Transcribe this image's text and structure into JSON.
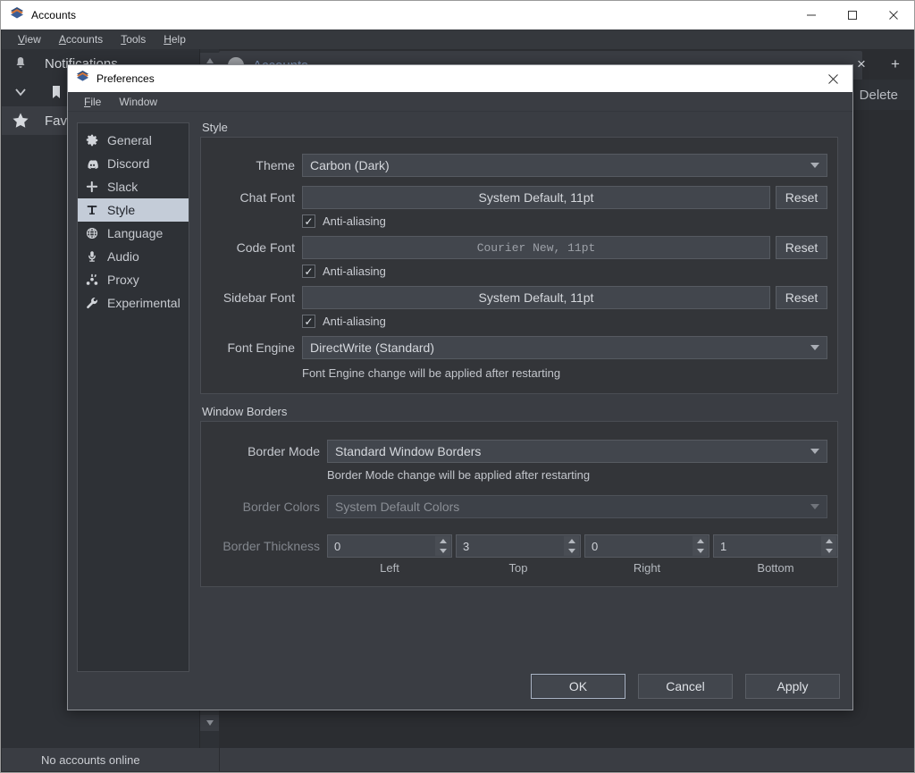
{
  "app": {
    "title": "Accounts",
    "title_icon": "app-logo-icon",
    "window_controls": [
      {
        "name": "minimize-button",
        "glyph": "minimize-icon"
      },
      {
        "name": "maximize-button",
        "glyph": "maximize-icon"
      },
      {
        "name": "close-button",
        "glyph": "close-icon"
      }
    ],
    "menus": [
      {
        "label": "View",
        "accel": "V"
      },
      {
        "label": "Accounts",
        "accel": "A"
      },
      {
        "label": "Tools",
        "accel": "T"
      },
      {
        "label": "Help",
        "accel": "H"
      }
    ],
    "sidebar": [
      {
        "icon": "bell-icon",
        "label": "Notifications",
        "highlighted": false
      },
      {
        "icon": "bookmark-icon",
        "label": "",
        "highlighted": false
      },
      {
        "icon": "star-icon",
        "label": "Favorites",
        "highlighted": true
      }
    ],
    "tab": {
      "label": "Accounts",
      "avatar": "avatar-icon",
      "close_glyph": "×",
      "add_glyph": "+"
    },
    "toolbar": {
      "delete_label": "Delete"
    },
    "statusbar": {
      "text": "No accounts online"
    },
    "scrollbar": {
      "up_glyph": "▲",
      "down_glyph": "▼"
    }
  },
  "prefs": {
    "title": "Preferences",
    "title_icon": "app-logo-icon",
    "close_glyph": "✕",
    "menus": [
      {
        "label": "File",
        "accel": "F"
      },
      {
        "label": "Window",
        "accel": ""
      }
    ],
    "nav": [
      {
        "icon": "gear-icon",
        "label": "General",
        "selected": false
      },
      {
        "icon": "discord-icon",
        "label": "Discord",
        "selected": false
      },
      {
        "icon": "slack-icon",
        "label": "Slack",
        "selected": false
      },
      {
        "icon": "text-t-icon",
        "label": "Style",
        "selected": true
      },
      {
        "icon": "globe-icon",
        "label": "Language",
        "selected": false
      },
      {
        "icon": "microphone-icon",
        "label": "Audio",
        "selected": false
      },
      {
        "icon": "proxy-icon",
        "label": "Proxy",
        "selected": false
      },
      {
        "icon": "wrench-icon",
        "label": "Experimental",
        "selected": false
      }
    ],
    "style_group": {
      "title": "Style",
      "theme": {
        "label": "Theme",
        "value": "Carbon (Dark)"
      },
      "chat_font": {
        "label": "Chat Font",
        "value": "System Default, 11pt",
        "reset_label": "Reset",
        "antialias_label": "Anti-aliasing",
        "antialias_checked": true,
        "check_glyph": "✓"
      },
      "code_font": {
        "label": "Code Font",
        "value": "Courier New, 11pt",
        "reset_label": "Reset",
        "antialias_label": "Anti-aliasing",
        "antialias_checked": true,
        "check_glyph": "✓"
      },
      "sidebar_font": {
        "label": "Sidebar Font",
        "value": "System Default, 11pt",
        "reset_label": "Reset",
        "antialias_label": "Anti-aliasing",
        "antialias_checked": true,
        "check_glyph": "✓"
      },
      "font_engine": {
        "label": "Font Engine",
        "value": "DirectWrite (Standard)",
        "note": "Font Engine change will be applied after restarting"
      }
    },
    "borders_group": {
      "title": "Window Borders",
      "border_mode": {
        "label": "Border Mode",
        "value": "Standard Window Borders",
        "note": "Border Mode change will be applied after restarting"
      },
      "border_colors": {
        "label": "Border Colors",
        "value": "System Default Colors",
        "disabled": true
      },
      "border_thickness": {
        "label": "Border Thickness",
        "disabled": true,
        "fields": [
          {
            "value": "0",
            "caption": "Left"
          },
          {
            "value": "3",
            "caption": "Top"
          },
          {
            "value": "0",
            "caption": "Right"
          },
          {
            "value": "1",
            "caption": "Bottom"
          }
        ]
      }
    },
    "buttons": {
      "ok": "OK",
      "cancel": "Cancel",
      "apply": "Apply"
    }
  },
  "colors": {
    "dialog_bg": "#3a3d43",
    "panel_bg": "#333539",
    "field_bg": "#42464d",
    "selection_bg": "#c4ccd8",
    "titlebar_bg": "#ffffff",
    "accent_link": "#7d94b8"
  }
}
